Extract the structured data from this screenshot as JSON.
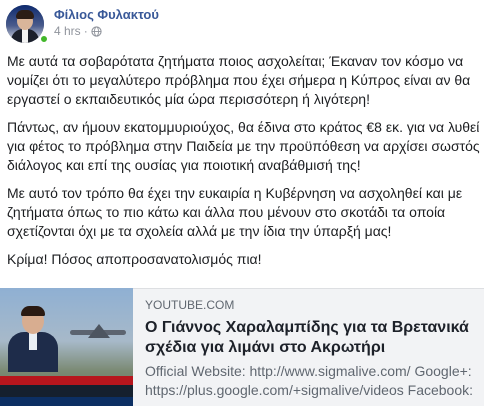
{
  "post": {
    "author": "Φίλιος Φυλακτού",
    "time": "4 hrs",
    "separator": "·",
    "privacy_icon": "globe-icon",
    "paragraphs": [
      "Με αυτά τα σοβαρότατα ζητήματα ποιος ασχολείται; Έκαναν τον κόσμο να νομίζει ότι το μεγαλύτερο πρόβλημα που έχει σήμερα η Κύπρος είναι αν θα εργαστεί ο εκπαιδευτικός μία ώρα περισσότερη ή λιγότερη!",
      "Πάντως, αν ήμουν εκατομμυριούχος, θα έδινα στο κράτος €8 εκ. για να λυθεί για φέτος το πρόβλημα στην Παιδεία με την προϋπόθεση να αρχίσει σωστός διάλογος και επί της ουσίας για ποιοτική αναβάθμισή της!",
      "Με αυτό τον τρόπο θα έχει την ευκαιρία η Κυβέρνηση να ασχοληθεί και με ζητήματα όπως το πιο κάτω και άλλα που μένουν στο σκοτάδι τα οποία σχετίζονται όχι με τα σχολεία αλλά με την ίδια την ύπαρξή μας!",
      "Κρίμα! Πόσος αποπροσανατολισμός πια!"
    ]
  },
  "link_card": {
    "domain": "YOUTUBE.COM",
    "title": "Ο Γιάννος Χαραλαμπίδης για τα Βρετανικά σχέδια για λιμάνι στο Ακρωτήρι",
    "description": "Official Website: http://www.sigmalive.com/ Google+: https://plus.google.com/+sigmalive/videos Facebook:",
    "thumbnail_icon": "video-thumbnail"
  },
  "colors": {
    "name_link": "#385898",
    "online": "#42b72a",
    "card_bg": "#f2f3f5"
  }
}
